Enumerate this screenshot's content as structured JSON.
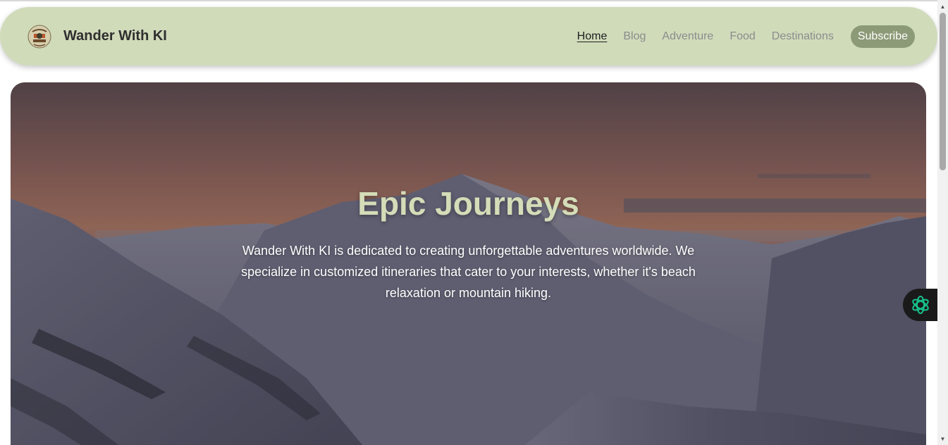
{
  "navbar": {
    "logo_icon": "wander-logo-badge",
    "brand_name": "Wander With KI",
    "links": [
      {
        "label": "Home",
        "active": true
      },
      {
        "label": "Blog",
        "active": false
      },
      {
        "label": "Adventure",
        "active": false
      },
      {
        "label": "Food",
        "active": false
      },
      {
        "label": "Destinations",
        "active": false
      }
    ],
    "subscribe_label": "Subscribe"
  },
  "hero": {
    "title": "Epic Journeys",
    "description": "Wander With KI is dedicated to creating unforgettable adventures worldwide. We specialize in customized itineraries that cater to your interests, whether it's beach relaxation or mountain hiking.",
    "background": "snowy-mountain-sunset-photo"
  },
  "assistant": {
    "icon": "openai-knot-icon"
  },
  "colors": {
    "navbar_bg": "#d0dbba",
    "subscribe_bg": "#8c9a77",
    "title_color": "#d4dcb8",
    "assistant_icon": "#16c48e"
  }
}
